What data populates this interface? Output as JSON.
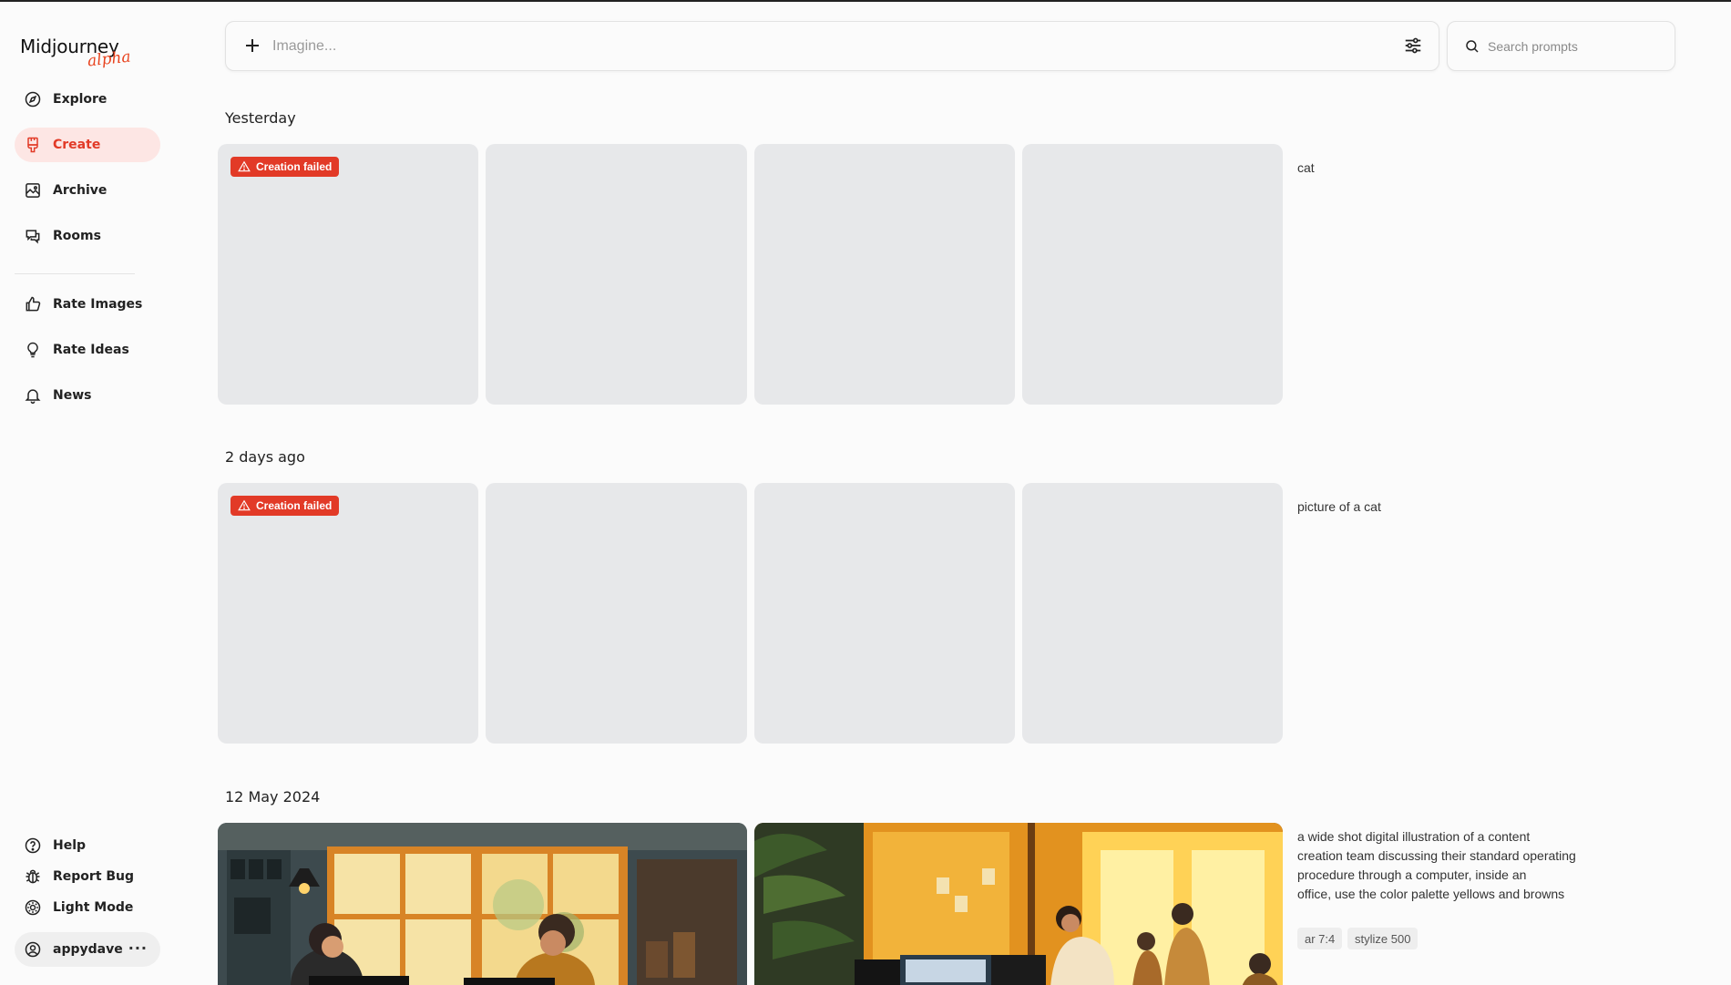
{
  "app": {
    "name": "Midjourney",
    "badge": "alpha"
  },
  "sidebar": {
    "items": [
      {
        "label": "Explore",
        "icon": "compass-icon"
      },
      {
        "label": "Create",
        "icon": "brush-icon",
        "active": true
      },
      {
        "label": "Archive",
        "icon": "image-icon"
      },
      {
        "label": "Rooms",
        "icon": "chat-icon"
      },
      {
        "label": "Rate Images",
        "icon": "thumbs-up-icon"
      },
      {
        "label": "Rate Ideas",
        "icon": "lightbulb-icon"
      },
      {
        "label": "News",
        "icon": "bell-icon"
      }
    ],
    "footer": [
      {
        "label": "Help",
        "icon": "help-icon"
      },
      {
        "label": "Report Bug",
        "icon": "bug-icon"
      },
      {
        "label": "Light Mode",
        "icon": "sun-icon"
      }
    ],
    "user": {
      "name": "appydave",
      "more": "···"
    }
  },
  "topbar": {
    "imagine_placeholder": "Imagine...",
    "search_placeholder": "Search prompts"
  },
  "sections": [
    {
      "title": "Yesterday",
      "prompt": "cat",
      "status": "Creation failed"
    },
    {
      "title": "2 days ago",
      "prompt": "picture of a cat",
      "status": "Creation failed"
    },
    {
      "title": "12 May 2024",
      "prompt_lines": [
        "a wide shot digital illustration of a content",
        "creation team discussing their standard operating",
        "procedure through a computer, inside an",
        "office, use the color palette yellows and browns"
      ],
      "tags": [
        "ar 7:4",
        "stylize 500"
      ]
    }
  ],
  "colors": {
    "accent": "#e23a27",
    "active_bg": "#fde6e4",
    "tile": "#e7e8ea"
  }
}
